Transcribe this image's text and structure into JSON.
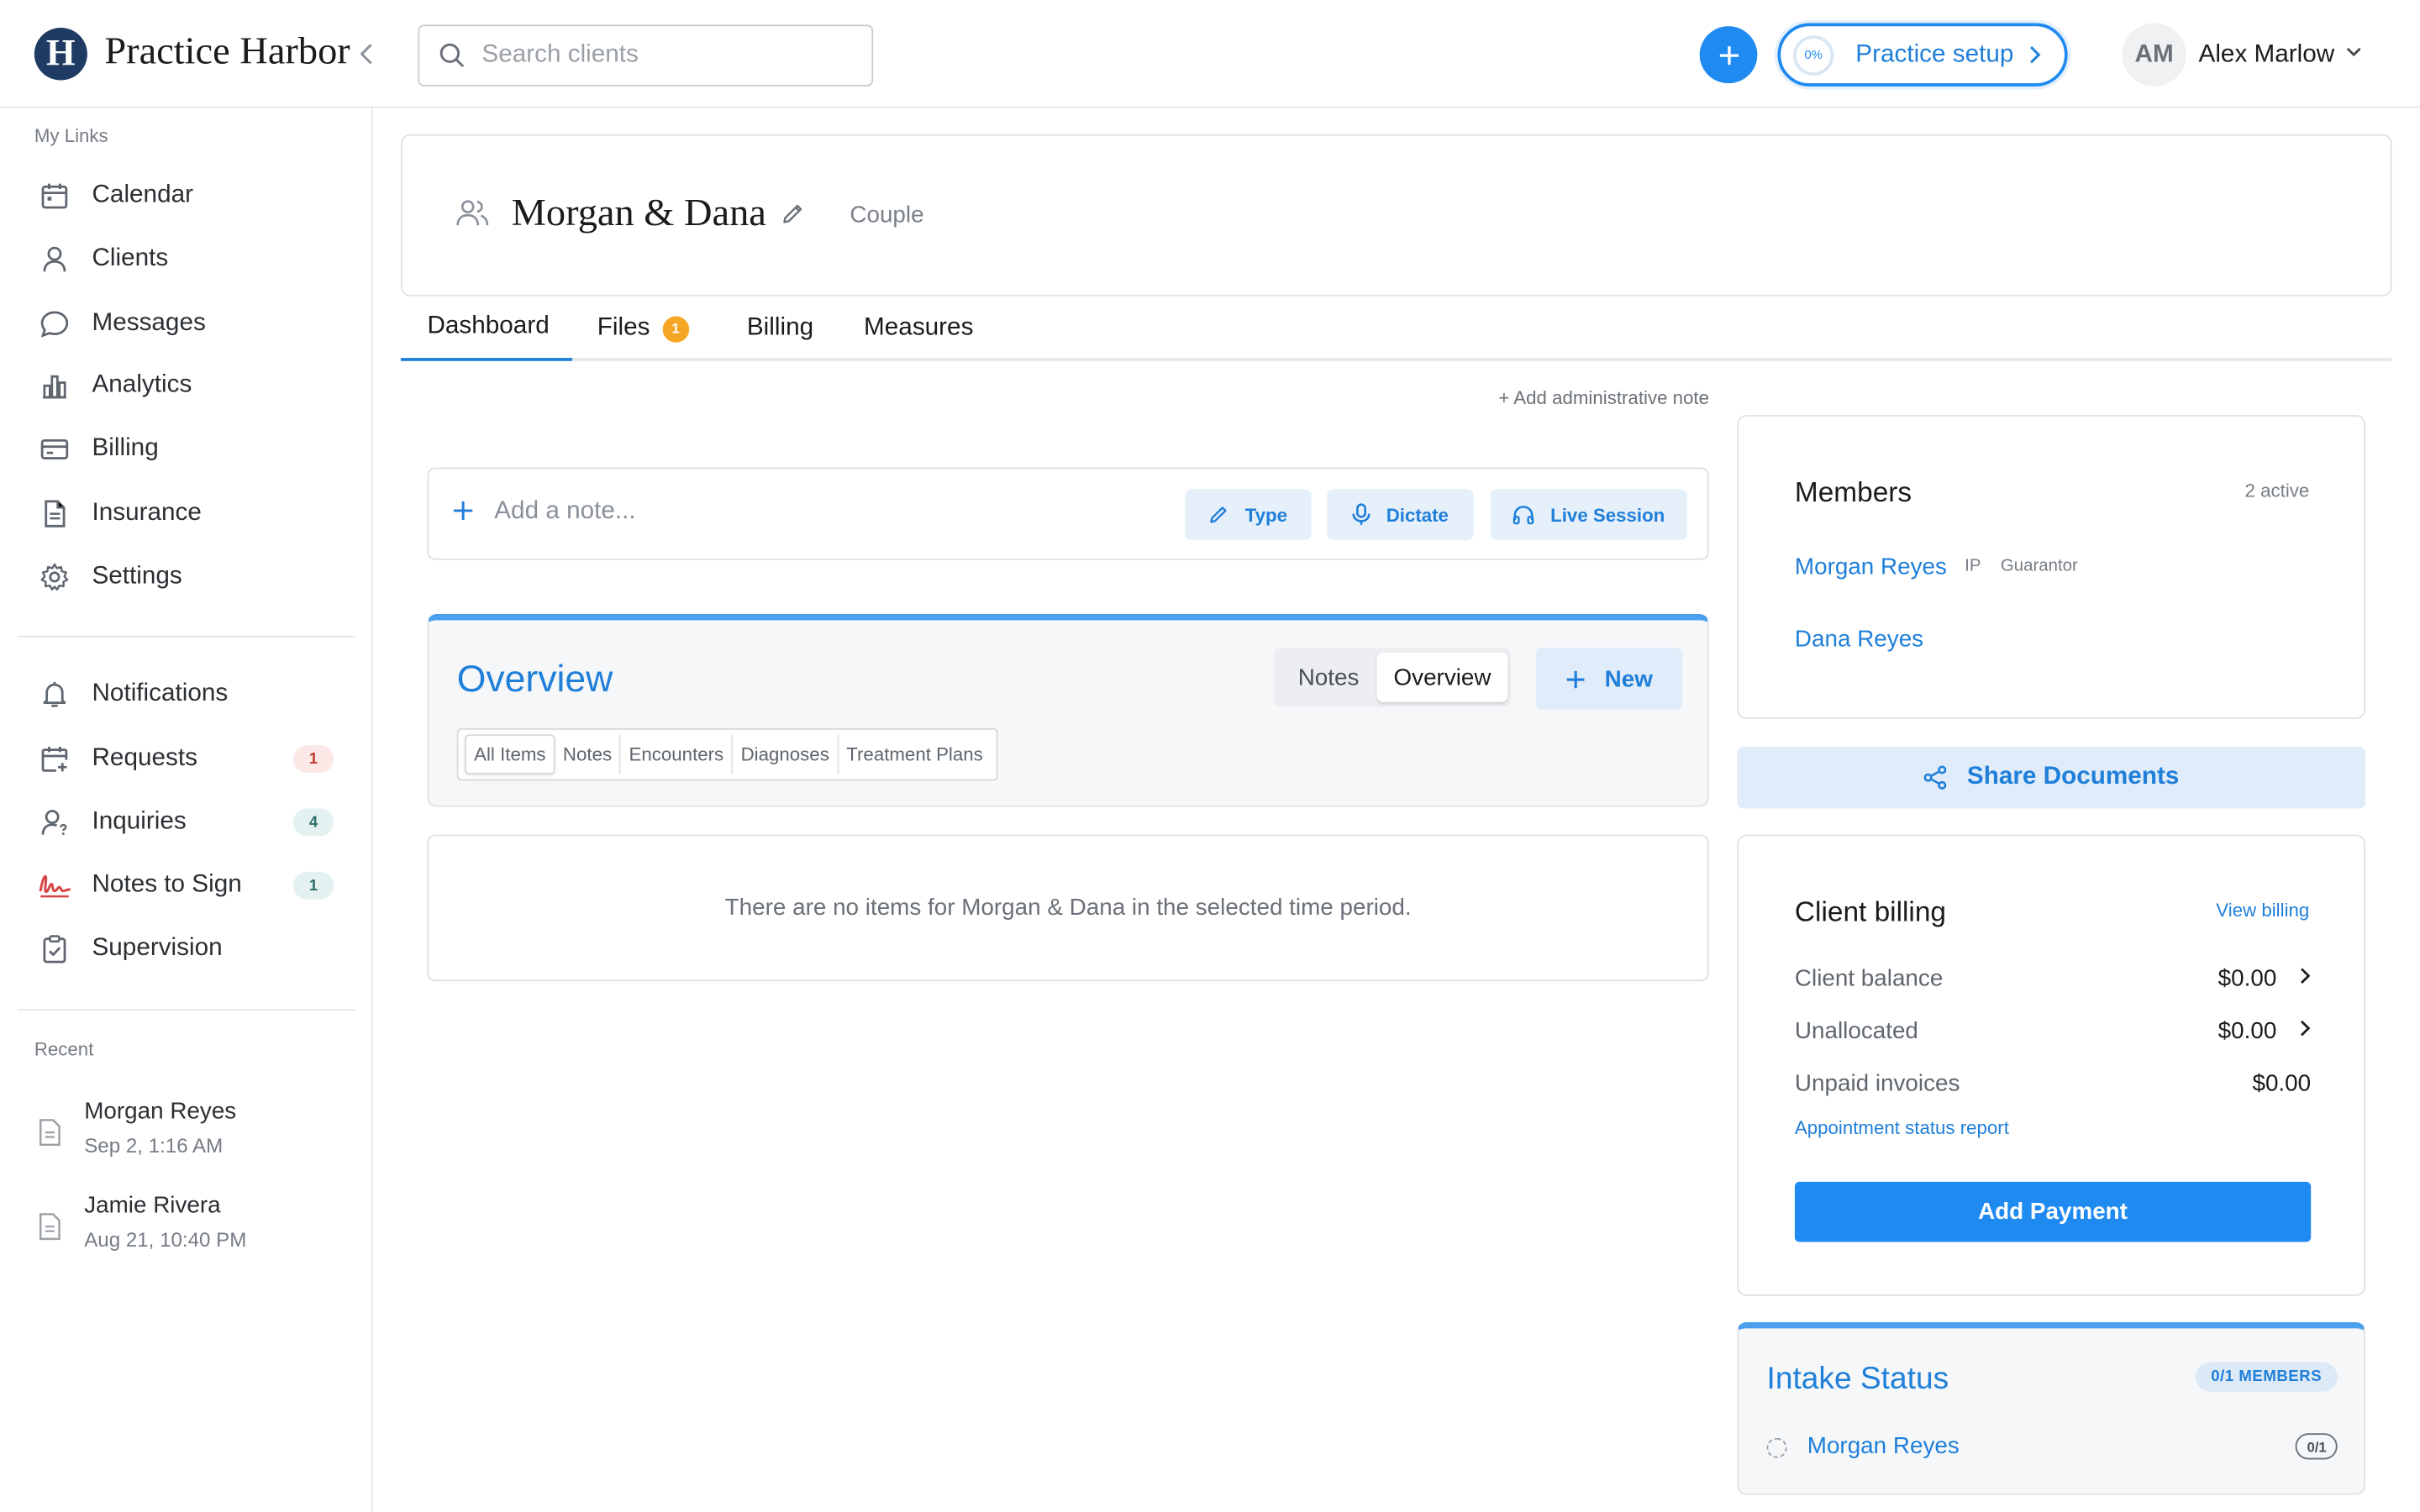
{
  "app": {
    "brand": "Practice Harbor",
    "logo_letter": "H"
  },
  "header": {
    "search_placeholder": "Search clients",
    "setup": {
      "progress": "0%",
      "label": "Practice setup"
    },
    "user": {
      "initials": "AM",
      "name": "Alex Marlow"
    }
  },
  "sidebar": {
    "section_label": "My Links",
    "links": [
      {
        "label": "Calendar",
        "icon": "calendar-icon"
      },
      {
        "label": "Clients",
        "icon": "user-icon"
      },
      {
        "label": "Messages",
        "icon": "chat-bubble-icon"
      },
      {
        "label": "Analytics",
        "icon": "bar-chart-icon"
      },
      {
        "label": "Billing",
        "icon": "credit-card-icon"
      },
      {
        "label": "Insurance",
        "icon": "document-icon"
      },
      {
        "label": "Settings",
        "icon": "gear-icon"
      }
    ],
    "tasks": [
      {
        "label": "Notifications",
        "icon": "bell-icon",
        "badge": ""
      },
      {
        "label": "Requests",
        "icon": "calendar-plus-icon",
        "badge": "1"
      },
      {
        "label": "Inquiries",
        "icon": "user-question-icon",
        "badge": "4"
      },
      {
        "label": "Notes to Sign",
        "icon": "signature-icon",
        "badge": "1"
      },
      {
        "label": "Supervision",
        "icon": "clipboard-check-icon",
        "badge": ""
      }
    ],
    "recent_label": "Recent",
    "recent": [
      {
        "name": "Morgan Reyes",
        "date": "Sep 2, 1:16 AM"
      },
      {
        "name": "Jamie Rivera",
        "date": "Aug 21, 10:40 PM"
      }
    ]
  },
  "client": {
    "name": "Morgan & Dana",
    "type": "Couple"
  },
  "tabs": [
    {
      "label": "Dashboard"
    },
    {
      "label": "Files",
      "badge": "1"
    },
    {
      "label": "Billing"
    },
    {
      "label": "Measures"
    }
  ],
  "admin_note_link": "+ Add administrative note",
  "composer": {
    "placeholder": "Add a note...",
    "actions": [
      "Type",
      "Dictate",
      "Live Session"
    ]
  },
  "overview": {
    "title": "Overview",
    "toggle": [
      "Notes",
      "Overview"
    ],
    "new_label": "New",
    "filters": [
      "All Items",
      "Notes",
      "Encounters",
      "Diagnoses",
      "Treatment Plans"
    ],
    "empty_text": "There are no items for Morgan & Dana in the selected time period."
  },
  "members": {
    "title": "Members",
    "count": "2 active",
    "list": [
      {
        "name": "Morgan Reyes",
        "tags": [
          "IP",
          "Guarantor"
        ]
      },
      {
        "name": "Dana Reyes",
        "tags": []
      }
    ]
  },
  "share_documents": "Share Documents",
  "billing": {
    "title": "Client billing",
    "view_link": "View billing",
    "rows": [
      {
        "label": "Client balance",
        "value": "$0.00"
      },
      {
        "label": "Unallocated",
        "value": "$0.00"
      },
      {
        "label": "Unpaid invoices",
        "value": "$0.00"
      }
    ],
    "report_link": "Appointment status report",
    "add_payment": "Add Payment"
  },
  "intake": {
    "title": "Intake Status",
    "badge": "0/1 MEMBERS",
    "rows": [
      {
        "name": "Morgan Reyes",
        "count": "0/1"
      }
    ]
  },
  "colors": {
    "accent": "#1f8af0",
    "link": "#1f7fd9",
    "brand_dark": "#1f3b63",
    "badge_warning": "#f5a623"
  }
}
